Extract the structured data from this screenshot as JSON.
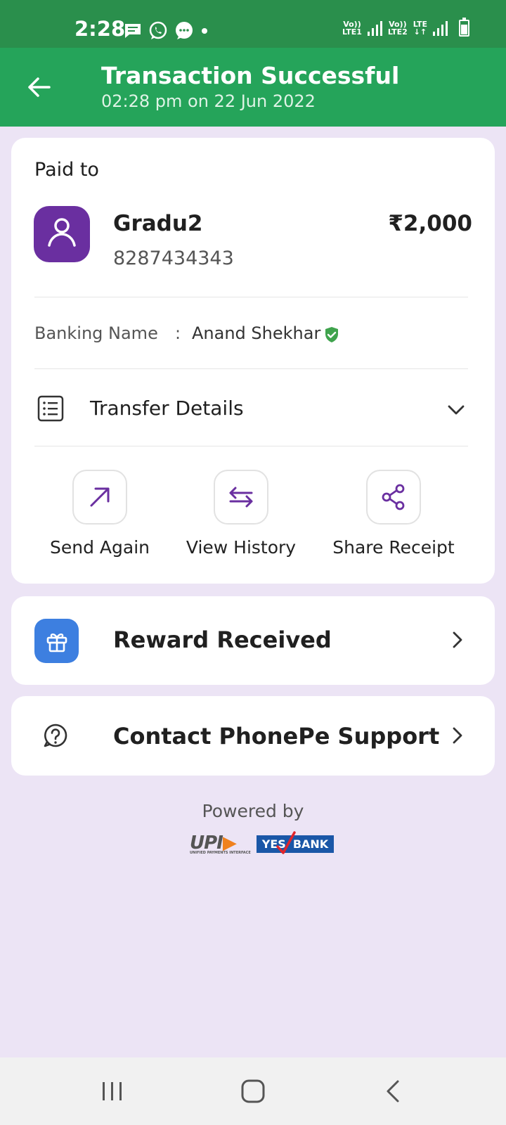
{
  "status_bar": {
    "time": "2:28",
    "network1": {
      "top": "Vo))",
      "bottom": "LTE1"
    },
    "network2": {
      "top": "Vo))",
      "bottom": "LTE2"
    },
    "network3": {
      "top": "LTE",
      "bottom": "↓↑"
    }
  },
  "header": {
    "title": "Transaction Successful",
    "subtitle": "02:28 pm on 22 Jun 2022",
    "color": "#25a45a"
  },
  "payment": {
    "paid_to_label": "Paid to",
    "payee_name": "Gradu2",
    "payee_phone": "8287434343",
    "amount": "₹2,000",
    "banking_name_label": "Banking Name",
    "banking_name_colon": ":",
    "banking_name_value": "Anand Shekhar"
  },
  "transfer_details": {
    "label": "Transfer Details"
  },
  "actions": [
    {
      "label": "Send Again",
      "icon": "arrow-up-right-icon"
    },
    {
      "label": "View History",
      "icon": "swap-arrows-icon"
    },
    {
      "label": "Share Receipt",
      "icon": "share-icon"
    }
  ],
  "reward": {
    "label": "Reward Received",
    "icon": "gift-icon"
  },
  "support": {
    "label": "Contact PhonePe Support",
    "icon": "help-icon"
  },
  "footer": {
    "powered_by": "Powered by",
    "upi_text": "UPI",
    "upi_subtext": "UNIFIED PAYMENTS INTERFACE",
    "bank_yes": "YES",
    "bank_name": "BANK"
  },
  "accent_color": "#6a2fa0"
}
